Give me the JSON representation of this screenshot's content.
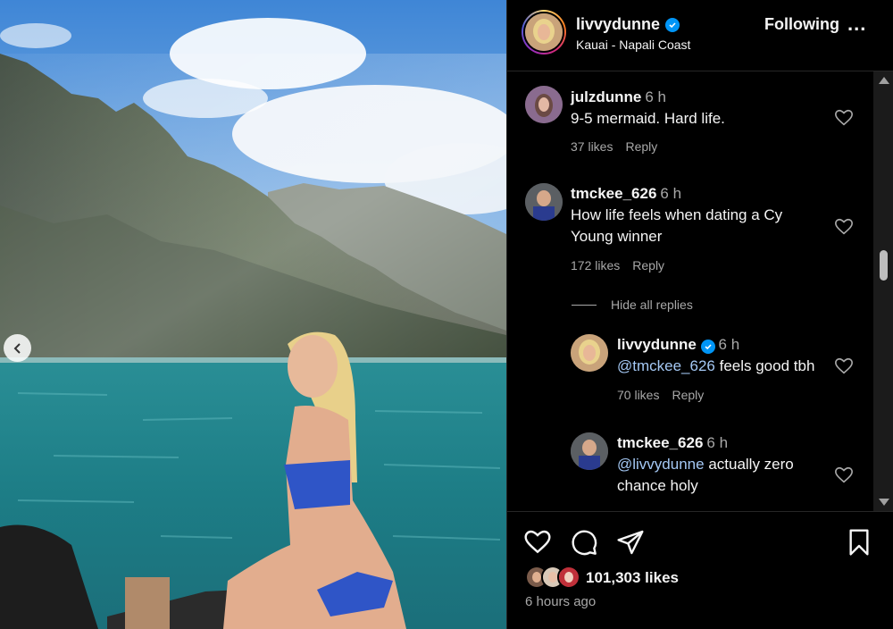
{
  "post": {
    "username": "livvydunne",
    "location": "Kauai - Napali Coast",
    "follow_label": "Following",
    "more_label": "...",
    "likes_text": "101,303 likes",
    "time_ago": "6 hours ago"
  },
  "comments": [
    {
      "username": "julzdunne",
      "time": "6 h",
      "text": "9-5 mermaid. Hard life.",
      "likes": "37 likes",
      "reply": "Reply"
    },
    {
      "username": "tmckee_626",
      "time": "6 h",
      "text_line1": "How life feels when dating a Cy",
      "text_line2": "Young winner",
      "likes": "172 likes",
      "reply": "Reply"
    }
  ],
  "hide_replies_label": "Hide all replies",
  "replies": [
    {
      "username": "livvydunne",
      "time": "6 h",
      "mention": "@tmckee_626",
      "text": " feels good tbh",
      "likes": "70 likes",
      "reply": "Reply"
    },
    {
      "username": "tmckee_626",
      "time": "6 h",
      "mention": "@livvydunne",
      "text_line1": " actually zero",
      "text_line2": "chance holy"
    }
  ],
  "colors": {
    "background": "#000000",
    "text": "#f5f5f5",
    "muted": "#a8a8a8",
    "mention": "#a4c8f4",
    "verified": "#0095f6"
  },
  "icons": [
    "chevron-left-icon",
    "verified-icon",
    "heart-icon",
    "comment-icon",
    "share-icon",
    "bookmark-icon"
  ]
}
